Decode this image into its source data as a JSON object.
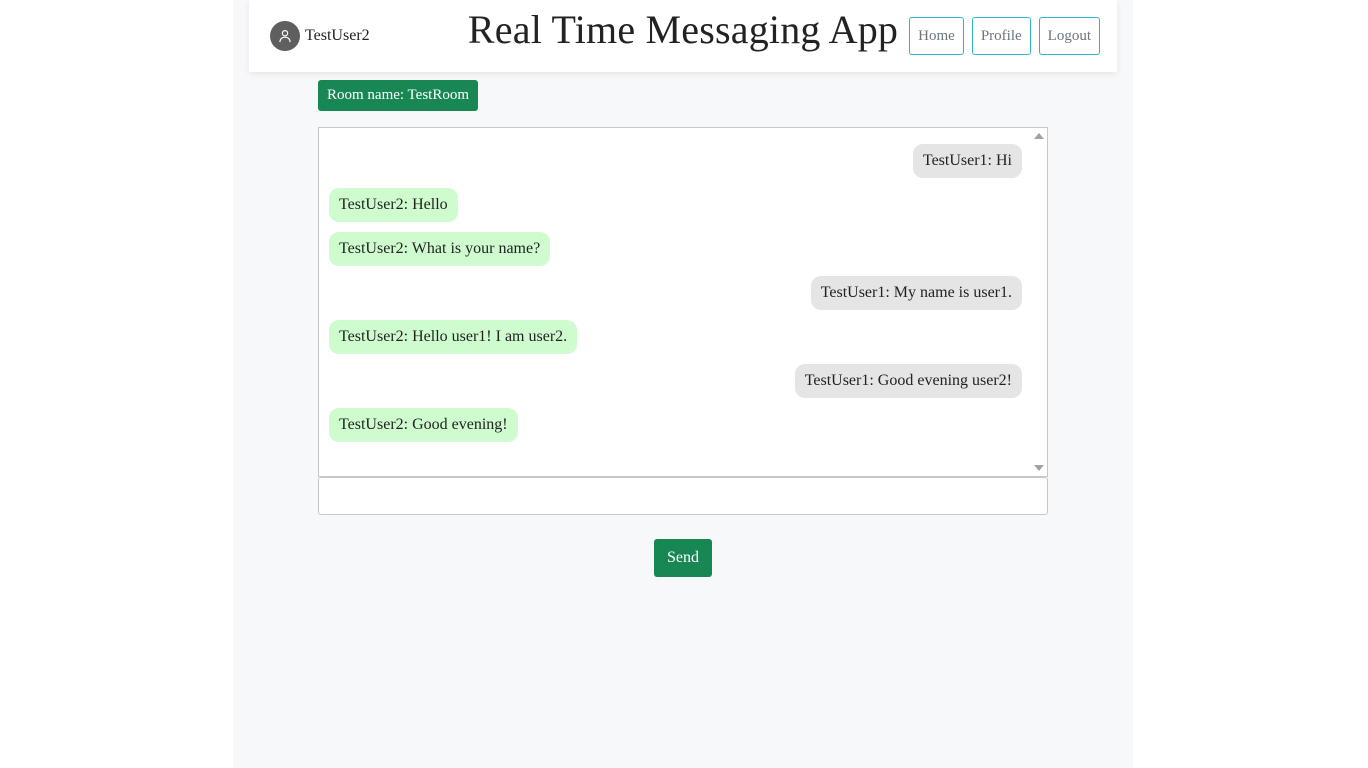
{
  "header": {
    "username": "TestUser2",
    "avatar_icon": "user-icon",
    "title": "Real Time Messaging App",
    "nav": [
      {
        "label": "Home"
      },
      {
        "label": "Profile"
      },
      {
        "label": "Logout"
      }
    ]
  },
  "room": {
    "label": "Room name: TestRoom"
  },
  "messages": [
    {
      "text": "TestUser1: Hi",
      "side": "other"
    },
    {
      "text": "TestUser2: Hello",
      "side": "me"
    },
    {
      "text": "TestUser2: What is your name?",
      "side": "me"
    },
    {
      "text": "TestUser1: My name is user1.",
      "side": "other"
    },
    {
      "text": "TestUser2: Hello user1! I am user2.",
      "side": "me"
    },
    {
      "text": "TestUser1: Good evening user2!",
      "side": "other"
    },
    {
      "text": "TestUser2: Good evening!",
      "side": "me"
    }
  ],
  "composer": {
    "value": "",
    "placeholder": "",
    "send_label": "Send"
  },
  "colors": {
    "accent": "#198754",
    "nav_border": "#29b6c9",
    "my_bubble": "#cffccf",
    "other_bubble": "#e5e5e5"
  }
}
